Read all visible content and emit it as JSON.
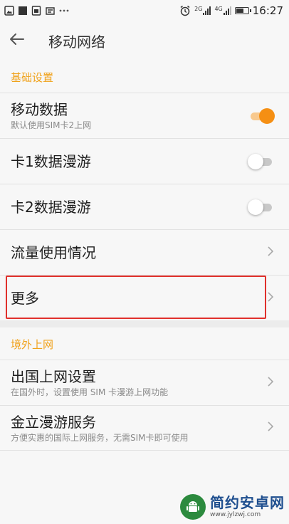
{
  "status_bar": {
    "time": "16:27",
    "network_1": "2G",
    "network_2": "4G",
    "signal_1": "signal-icon",
    "signal_2": "signal-icon",
    "battery_level": 0.65
  },
  "titlebar": {
    "back_icon": "arrow-left-icon",
    "title": "移动网络"
  },
  "sections": [
    {
      "header": "基础设置",
      "items": [
        {
          "title": "移动数据",
          "subtitle": "默认使用SIM卡2上网",
          "control": "toggle",
          "on": true
        },
        {
          "title": "卡1数据漫游",
          "control": "toggle",
          "on": false
        },
        {
          "title": "卡2数据漫游",
          "control": "toggle",
          "on": false
        },
        {
          "title": "流量使用情况",
          "control": "chevron"
        },
        {
          "title": "更多",
          "control": "chevron",
          "highlighted": true
        }
      ]
    },
    {
      "header": "境外上网",
      "items": [
        {
          "title": "出国上网设置",
          "subtitle": "在国外时，设置使用 SIM 卡漫游上网功能",
          "control": "chevron"
        },
        {
          "title": "金立漫游服务",
          "subtitle": "方便实惠的国际上网服务，无需SIM卡即可使用",
          "control": "chevron"
        }
      ]
    }
  ],
  "watermark": {
    "name": "简约安卓网",
    "url": "www.jylzwj.com"
  },
  "colors": {
    "accent": "#f58f13",
    "section_header": "#f0a21b",
    "highlight_box": "#e0302b"
  }
}
